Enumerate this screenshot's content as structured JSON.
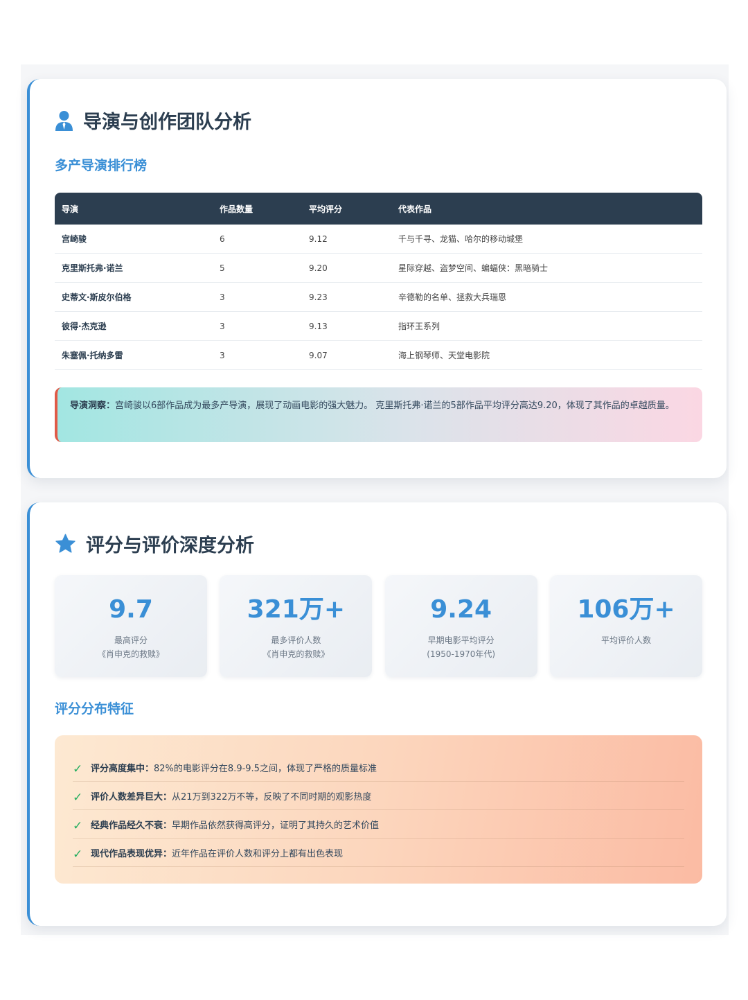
{
  "section1": {
    "title": "导演与创作团队分析",
    "icon": "user-tie-icon",
    "subtitle": "多产导演排行榜",
    "table": {
      "headers": [
        "导演",
        "作品数量",
        "平均评分",
        "代表作品"
      ],
      "rows": [
        [
          "宫崎骏",
          "6",
          "9.12",
          "千与千寻、龙猫、哈尔的移动城堡"
        ],
        [
          "克里斯托弗·诺兰",
          "5",
          "9.20",
          "星际穿越、盗梦空间、蝙蝠侠：黑暗骑士"
        ],
        [
          "史蒂文·斯皮尔伯格",
          "3",
          "9.23",
          "辛德勒的名单、拯救大兵瑞恩"
        ],
        [
          "彼得·杰克逊",
          "3",
          "9.13",
          "指环王系列"
        ],
        [
          "朱塞佩·托纳多雷",
          "3",
          "9.07",
          "海上钢琴师、天堂电影院"
        ]
      ]
    },
    "insight": {
      "lead": "导演洞察：",
      "text": "宫崎骏以6部作品成为最多产导演，展现了动画电影的强大魅力。 克里斯托弗·诺兰的5部作品平均评分高达9.20，体现了其作品的卓越质量。"
    }
  },
  "section2": {
    "title": "评分与评价深度分析",
    "icon": "star-icon",
    "stats": [
      {
        "value": "9.7",
        "label": "最高评分",
        "note": "《肖申克的救赎》"
      },
      {
        "value": "321万+",
        "label": "最多评价人数",
        "note": "《肖申克的救赎》"
      },
      {
        "value": "9.24",
        "label": "早期电影平均评分",
        "note": "(1950-1970年代)"
      },
      {
        "value": "106万+",
        "label": "平均评价人数",
        "note": ""
      }
    ],
    "subtitle": "评分分布特征",
    "features": [
      {
        "lead": "评分高度集中：",
        "text": "82%的电影评分在8.9-9.5之间，体现了严格的质量标准"
      },
      {
        "lead": "评价人数差异巨大：",
        "text": "从21万到322万不等，反映了不同时期的观影热度"
      },
      {
        "lead": "经典作品经久不衰：",
        "text": "早期作品依然获得高评分，证明了其持久的艺术价值"
      },
      {
        "lead": "现代作品表现优异：",
        "text": "近年作品在评价人数和评分上都有出色表现"
      }
    ],
    "check_icon": "check-icon"
  },
  "colors": {
    "accent": "#3a8fd6",
    "header_bg": "#2c3e50",
    "insight_border": "#e05a47",
    "check": "#27ae60"
  }
}
